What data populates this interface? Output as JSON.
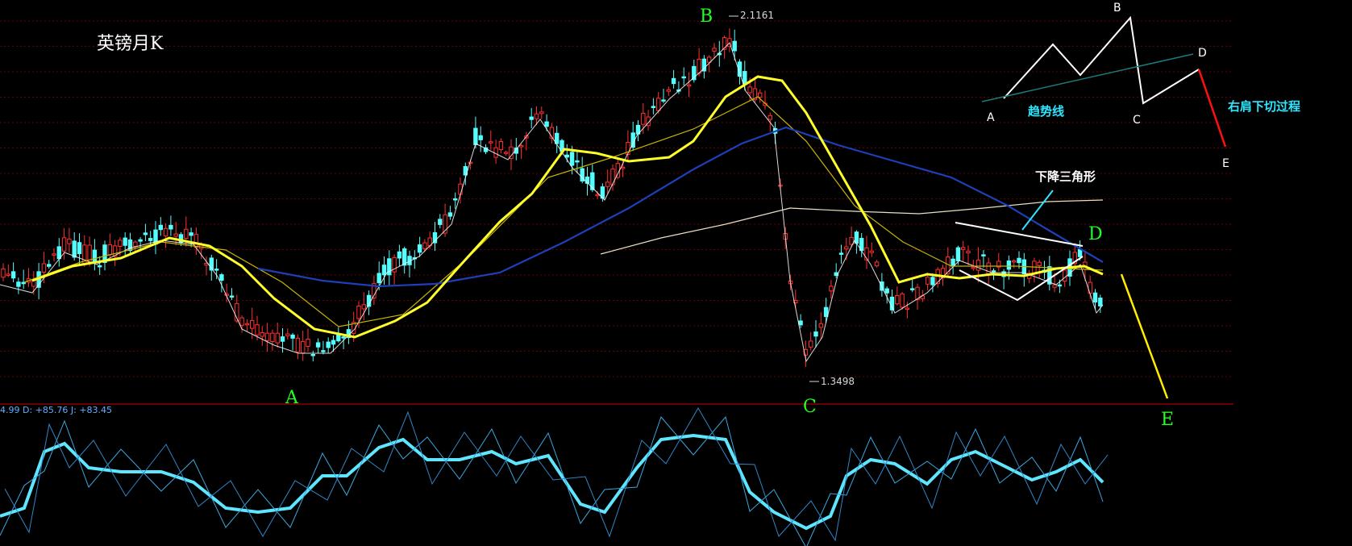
{
  "title": "英镑月K",
  "max_label": "2.1161",
  "min_label": "1.3498",
  "wave_labels": {
    "A": "A",
    "B": "B",
    "C": "C",
    "D": "D",
    "E": "E"
  },
  "indicator_readout": "4.99 D: +85.76 J: +83.45",
  "inset": {
    "trendline_label": "趋势线",
    "process_label": "右肩下切过程",
    "points": {
      "A": "A",
      "B": "B",
      "C": "C",
      "D": "D",
      "E": "E"
    }
  },
  "triangle_label": "下降三角形",
  "colors": {
    "background": "#000000",
    "up_candle": "#ff3030",
    "down_candle": "#54ffff",
    "ma_thick": "#ffff2a",
    "ma_blue": "#1e3fb8",
    "ma_long": "#e8e0c0",
    "wave_label": "#22ff22",
    "kdj": "#5fe6ff",
    "inset_label": "#2ee6ff",
    "projection": "#ffee00"
  },
  "chart_data": {
    "type": "candlestick",
    "title": "英镑月K",
    "annotations": [
      "2.1161",
      "1.3498",
      "A",
      "B",
      "C",
      "D",
      "E",
      "下降三角形"
    ],
    "price_axis_range": [
      1.3498,
      2.1161
    ],
    "indicator": {
      "name": "KDJ",
      "D": 85.76,
      "J": 83.45
    }
  }
}
